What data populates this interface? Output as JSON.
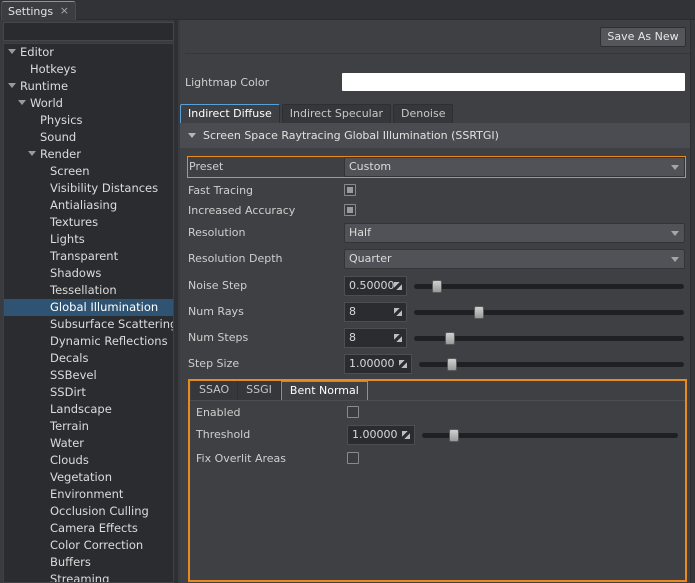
{
  "window": {
    "tab_title": "Settings",
    "close_glyph": "×"
  },
  "sidebar": {
    "search_placeholder": "",
    "items": [
      {
        "label": "Editor",
        "level": 0,
        "expanded": true
      },
      {
        "label": "Hotkeys",
        "level": 1
      },
      {
        "label": "Runtime",
        "level": 0,
        "expanded": true
      },
      {
        "label": "World",
        "level": 1,
        "expanded": true
      },
      {
        "label": "Physics",
        "level": 2
      },
      {
        "label": "Sound",
        "level": 2
      },
      {
        "label": "Render",
        "level": 2,
        "expanded": true
      },
      {
        "label": "Screen",
        "level": 3
      },
      {
        "label": "Visibility Distances",
        "level": 3
      },
      {
        "label": "Antialiasing",
        "level": 3
      },
      {
        "label": "Textures",
        "level": 3
      },
      {
        "label": "Lights",
        "level": 3
      },
      {
        "label": "Transparent",
        "level": 3
      },
      {
        "label": "Shadows",
        "level": 3
      },
      {
        "label": "Tessellation",
        "level": 3
      },
      {
        "label": "Global Illumination",
        "level": 3,
        "selected": true
      },
      {
        "label": "Subsurface Scattering",
        "level": 3
      },
      {
        "label": "Dynamic Reflections",
        "level": 3
      },
      {
        "label": "Decals",
        "level": 3
      },
      {
        "label": "SSBevel",
        "level": 3
      },
      {
        "label": "SSDirt",
        "level": 3
      },
      {
        "label": "Landscape",
        "level": 3
      },
      {
        "label": "Terrain",
        "level": 3
      },
      {
        "label": "Water",
        "level": 3
      },
      {
        "label": "Clouds",
        "level": 3
      },
      {
        "label": "Vegetation",
        "level": 3
      },
      {
        "label": "Environment",
        "level": 3
      },
      {
        "label": "Occlusion Culling",
        "level": 3
      },
      {
        "label": "Camera Effects",
        "level": 3
      },
      {
        "label": "Color Correction",
        "level": 3
      },
      {
        "label": "Buffers",
        "level": 3
      },
      {
        "label": "Streaming",
        "level": 3
      }
    ]
  },
  "main": {
    "save_as_new_label": "Save As New",
    "lightmap_color_label": "Lightmap Color",
    "lightmap_color_value": "#ffffff",
    "tabs": [
      {
        "label": "Indirect Diffuse",
        "active": true
      },
      {
        "label": "Indirect Specular"
      },
      {
        "label": "Denoise"
      }
    ],
    "section_title": "Screen Space Raytracing Global Illumination (SSRTGI)",
    "preset": {
      "label": "Preset",
      "value": "Custom"
    },
    "fast_tracing": {
      "label": "Fast Tracing",
      "checked": true
    },
    "increased_accuracy": {
      "label": "Increased Accuracy",
      "checked": true
    },
    "resolution": {
      "label": "Resolution",
      "value": "Half"
    },
    "resolution_depth": {
      "label": "Resolution Depth",
      "value": "Quarter"
    },
    "noise_step": {
      "label": "Noise Step",
      "value": "0.50000",
      "slider_fraction": 0.07
    },
    "num_rays": {
      "label": "Num Rays",
      "value": "8",
      "slider_fraction": 0.23
    },
    "num_steps": {
      "label": "Num Steps",
      "value": "8",
      "slider_fraction": 0.12
    },
    "step_size": {
      "label": "Step Size",
      "value": "1.00000",
      "slider_fraction": 0.11
    },
    "subtabs": [
      {
        "label": "SSAO"
      },
      {
        "label": "SSGI"
      },
      {
        "label": "Bent Normal",
        "active": true
      }
    ],
    "bent_normal": {
      "enabled": {
        "label": "Enabled",
        "checked": false
      },
      "threshold": {
        "label": "Threshold",
        "value": "1.00000",
        "slider_fraction": 0.11
      },
      "fix_overlit": {
        "label": "Fix Overlit Areas",
        "checked": false
      }
    }
  },
  "colors": {
    "accent_orange": "#e88a1e",
    "selection_blue": "#2f5473",
    "tab_highlight": "#5aa0d8"
  }
}
